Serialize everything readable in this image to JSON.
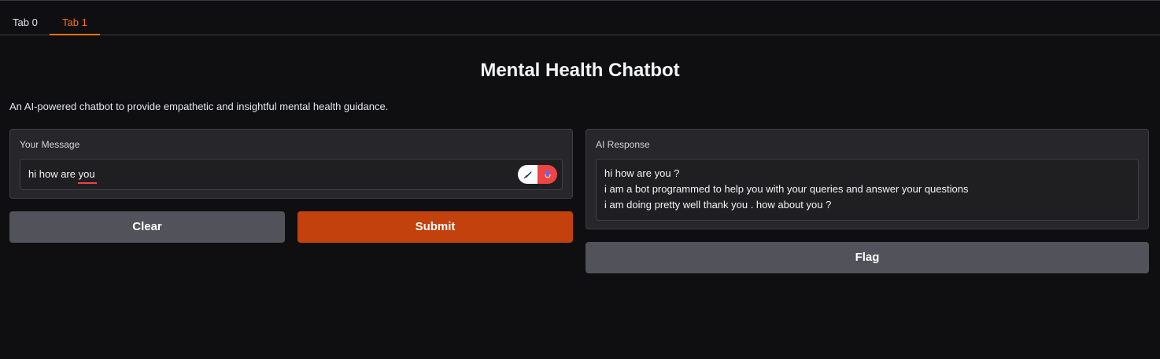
{
  "tabs": [
    {
      "label": "Tab 0",
      "active": false
    },
    {
      "label": "Tab 1",
      "active": true
    }
  ],
  "header": {
    "title": "Mental Health Chatbot",
    "description": "An AI-powered chatbot to provide empathetic and insightful mental health guidance."
  },
  "input_panel": {
    "label": "Your Message",
    "value": "hi how are you",
    "icons": [
      "quill-extension-icon",
      "record-extension-icon"
    ]
  },
  "output_panel": {
    "label": "AI Response",
    "lines": [
      "hi how are you  ?",
      "i am a bot programmed to help you with your queries and answer your questions",
      "i am doing pretty well thank you . how about you ?"
    ]
  },
  "buttons": {
    "clear": "Clear",
    "submit": "Submit",
    "flag": "Flag"
  },
  "colors": {
    "background": "#0f0f11",
    "accent": "#f97316",
    "primary_button": "#c2410c",
    "secondary_button": "#52525b"
  }
}
